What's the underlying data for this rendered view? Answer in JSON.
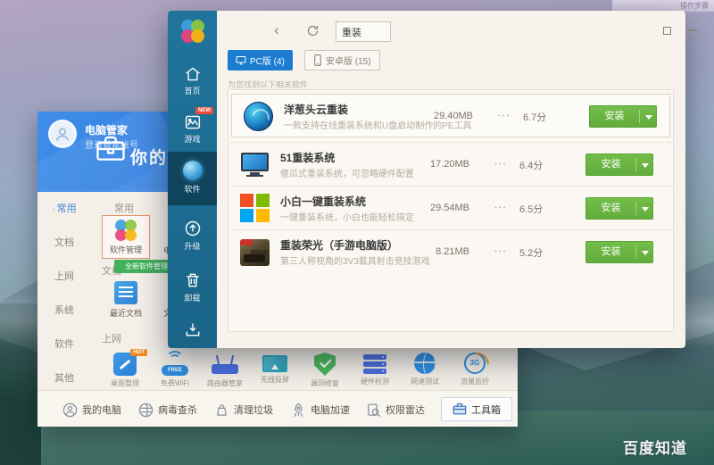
{
  "desktop": {
    "watermark": "百度知道",
    "corner_text": "操作步骤"
  },
  "manager_window": {
    "app_title": "电脑管家",
    "login_text": "登录管家帐号",
    "header_title": "你的电脑",
    "categories": [
      {
        "label": "常用",
        "marker": "·"
      },
      {
        "label": "文档"
      },
      {
        "label": "上网"
      },
      {
        "label": "系统"
      },
      {
        "label": "软件"
      },
      {
        "label": "其他"
      }
    ],
    "section_common": "常用",
    "section_docs": "文档",
    "section_net": "上网",
    "tooltip": "全新软件管理上线啦",
    "tools_common": [
      {
        "label": "软件管理"
      },
      {
        "label": "电脑诊所"
      }
    ],
    "tools_docs": [
      {
        "label": "最近文档"
      },
      {
        "label": "文件粉碎"
      }
    ],
    "tool_row": [
      {
        "label": "桌面整理",
        "badge": "HOT"
      },
      {
        "label": "免费WiFi",
        "pill": "FREE"
      },
      {
        "label": "路由器管家"
      },
      {
        "label": "无线投屏"
      },
      {
        "label": "漏洞修复"
      },
      {
        "label": "硬件检测"
      },
      {
        "label": "网速测试"
      },
      {
        "label": "流量监控",
        "pill": "3G"
      }
    ],
    "bottom_nav": [
      {
        "label": "我的电脑"
      },
      {
        "label": "病毒查杀"
      },
      {
        "label": "清理垃圾"
      },
      {
        "label": "电脑加速"
      },
      {
        "label": "权限雷达"
      },
      {
        "label": "工具箱",
        "active": true
      }
    ]
  },
  "software_window": {
    "sidebar": [
      {
        "label": "首页"
      },
      {
        "label": "游戏",
        "badge": "NEW"
      },
      {
        "label": "软件",
        "active": true
      },
      {
        "label": "升级"
      },
      {
        "label": "卸载"
      }
    ],
    "search": {
      "value": "重装"
    },
    "tabs": [
      {
        "label": "PC版 (4)",
        "active": true
      },
      {
        "label": "安卓版 (15)"
      }
    ],
    "result_hint": "为您找到以下相关软件",
    "install_label": "安装",
    "rating_dots": "•••",
    "close_glyph": "×",
    "back_glyph": "‹",
    "apps": [
      {
        "name": "洋葱头云重装",
        "desc": "一款支持在线重装系统和U盘启动制作的PE工具",
        "size": "29.40MB",
        "rating": "6.7分"
      },
      {
        "name": "51重装系统",
        "desc": "傻瓜式重装系统，可忽略硬件配置",
        "size": "17.20MB",
        "rating": "6.4分"
      },
      {
        "name": "小白一键重装系统",
        "desc": "一键重装系统，小白也能轻松搞定",
        "size": "29.54MB",
        "rating": "6.5分"
      },
      {
        "name": "重装荣光（手游电脑版）",
        "desc": "第三人称视角的3V3载具射击竞技游戏",
        "size": "8.21MB",
        "rating": "5.2分"
      }
    ]
  }
}
